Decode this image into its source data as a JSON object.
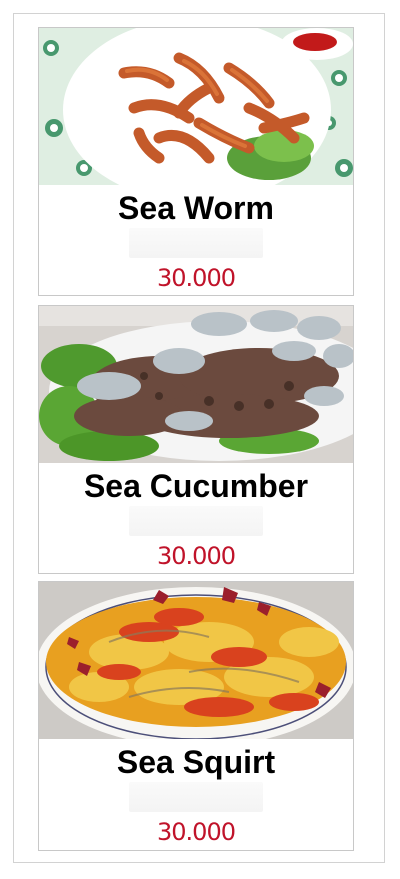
{
  "menu": {
    "items": [
      {
        "name": "Sea Worm",
        "price": "30.000",
        "image_icon": "sea-worm-dish-photo"
      },
      {
        "name": "Sea Cucumber",
        "price": "30.000",
        "image_icon": "sea-cucumber-dish-photo"
      },
      {
        "name": "Sea Squirt",
        "price": "30.000",
        "image_icon": "sea-squirt-dish-photo"
      }
    ]
  },
  "colors": {
    "price": "#c0132a",
    "card_border": "#c8c8c8",
    "frame_border": "#d2d2d2"
  }
}
